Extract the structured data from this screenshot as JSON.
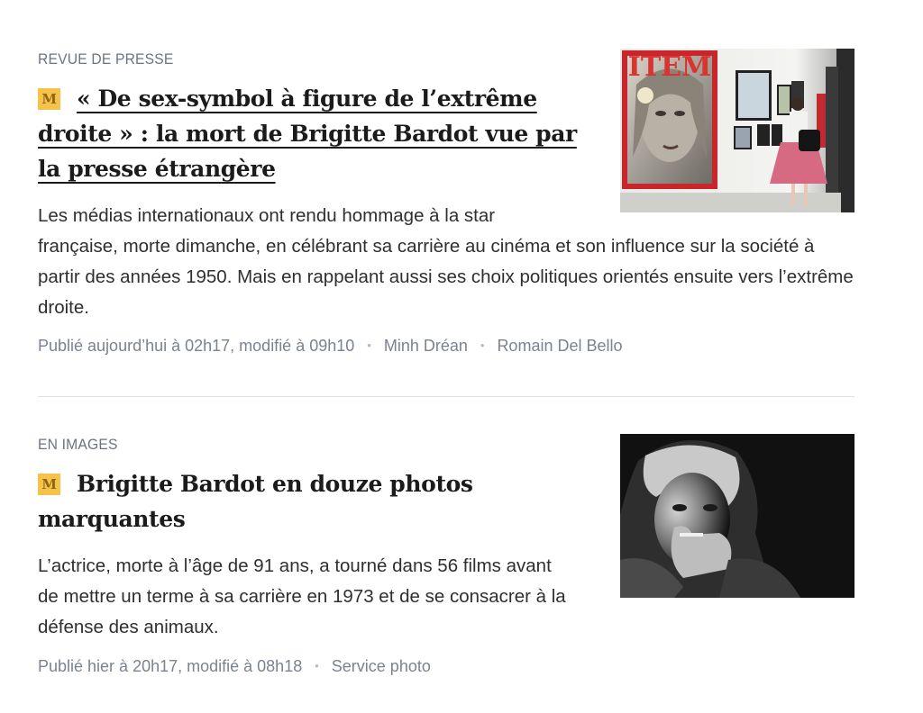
{
  "articles": [
    {
      "kicker": "Revue de presse",
      "premium_icon_glyph": "M",
      "title": "« De sex-symbol à figure de l’extrême droite » : la mort de Brigitte Bardot vue par la presse étrangère",
      "lede": "Les médias internationaux ont rendu hommage à la star française, morte dimanche, en célébrant sa carrière au cinéma et son influence sur la société à partir des années 1950. Mais en rappelant aussi ses choix politiques orientés ensuite vers l’extrême droite.",
      "published": "Publié aujourd’hui à 02h17, modifié à 09h10",
      "authors": [
        "Minh Dréan",
        "Romain Del Bello"
      ],
      "image_magazine_text": "ITEM"
    },
    {
      "kicker": "En images",
      "premium_icon_glyph": "M",
      "title": "Brigitte Bardot en douze photos marquantes",
      "lede": "L’actrice, morte à l’âge de 91 ans, a tourné dans 56 films avant de mettre un terme à sa carrière en 1973 et de se consacrer à la défense des animaux.",
      "published": "Publié hier à 20h17, modifié à 08h18",
      "authors": [
        "Service photo"
      ]
    }
  ],
  "colors": {
    "premium_badge": "#f5c24a",
    "meta_text": "#7b8290",
    "kicker_text": "#6b7382",
    "divider": "#dfe1e5"
  }
}
